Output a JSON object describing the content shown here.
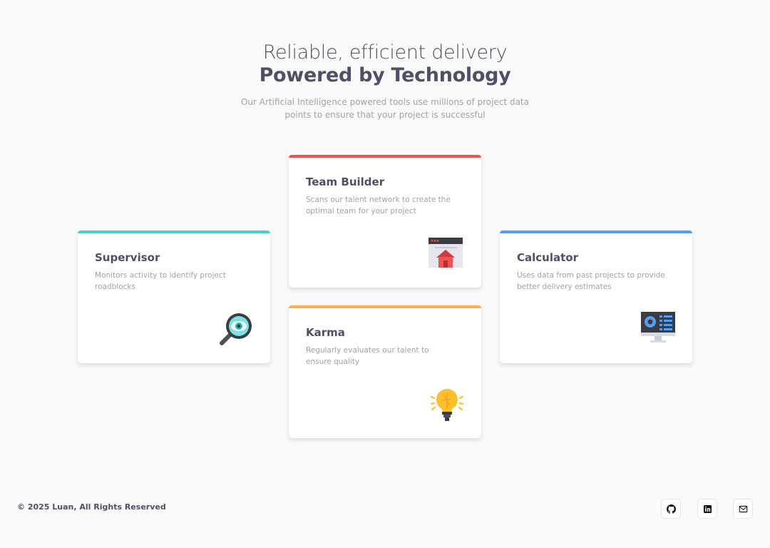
{
  "header": {
    "line1": "Reliable, efficient delivery",
    "line2": "Powered by Technology",
    "description": "Our Artificial Intelligence powered tools use millions of project data points to ensure that your project is successful"
  },
  "cards": {
    "supervisor": {
      "title": "Supervisor",
      "description": "Monitors activity to identify project roadblocks",
      "accent": "#44d3d2",
      "icon": "magnifier-eye-icon"
    },
    "team_builder": {
      "title": "Team Builder",
      "description": "Scans our talent network to create the optimal team for your project",
      "accent": "#ea5454",
      "icon": "browser-house-icon"
    },
    "karma": {
      "title": "Karma",
      "description": "Regularly evaluates our talent to ensure quality",
      "accent": "#fcaf4a",
      "icon": "lightbulb-icon"
    },
    "calculator": {
      "title": "Calculator",
      "description": "Uses data from past projects to provide better delivery estimates",
      "accent": "#549ef2",
      "icon": "monitor-chart-icon"
    }
  },
  "footer": {
    "copyright": "© 2025 Luan, All Rights Reserved",
    "social": [
      "github-icon",
      "linkedin-icon",
      "mail-icon"
    ]
  }
}
